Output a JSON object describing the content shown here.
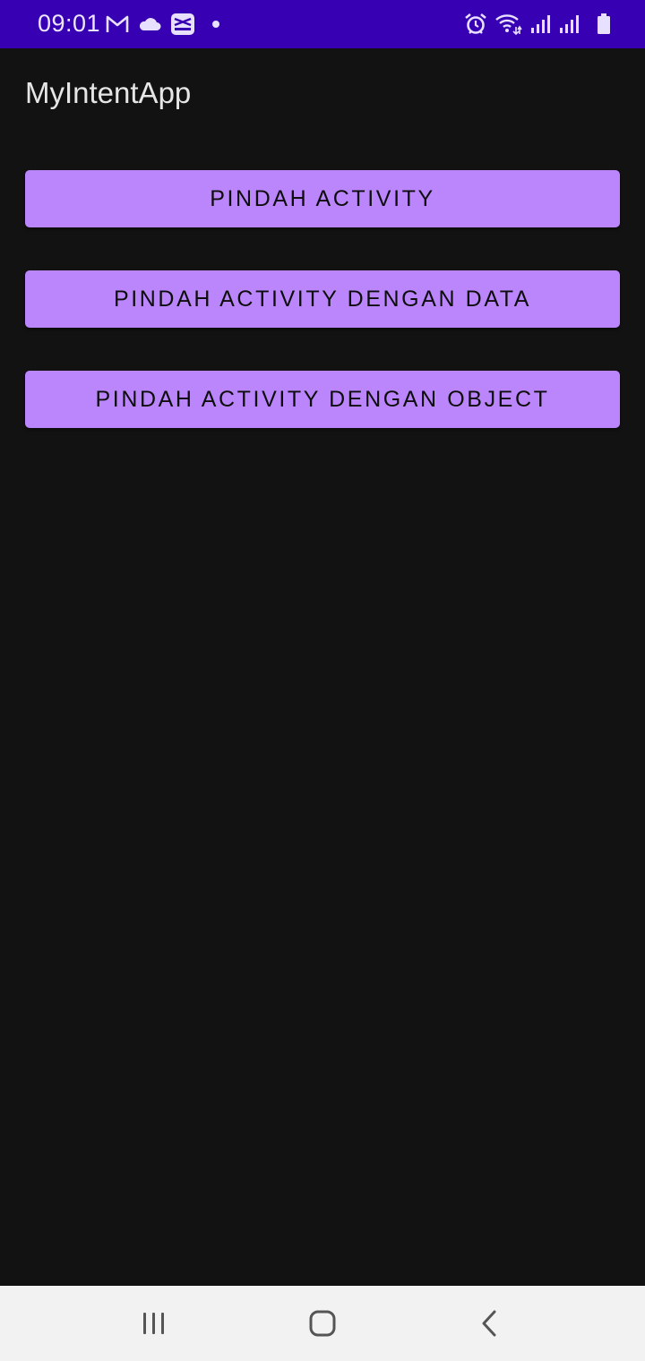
{
  "status_bar": {
    "time": "09:01",
    "left_icons": [
      "gmail-icon",
      "cloud-icon",
      "capcut-icon",
      "dot-icon"
    ],
    "right_icons": [
      "alarm-icon",
      "wifi-icon",
      "signal-icon",
      "signal-icon",
      "battery-icon"
    ],
    "background_color": "#3700b3"
  },
  "app_bar": {
    "title": "MyIntentApp"
  },
  "buttons": [
    {
      "label": "PINDAH ACTIVITY"
    },
    {
      "label": "PINDAH ACTIVITY DENGAN DATA"
    },
    {
      "label": "PINDAH ACTIVITY DENGAN OBJECT"
    }
  ],
  "colors": {
    "accent": "#bb86fc",
    "background": "#121212",
    "nav_bar": "#f2f2f2"
  },
  "nav_bar": {
    "buttons": [
      "recents-icon",
      "home-icon",
      "back-icon"
    ]
  }
}
